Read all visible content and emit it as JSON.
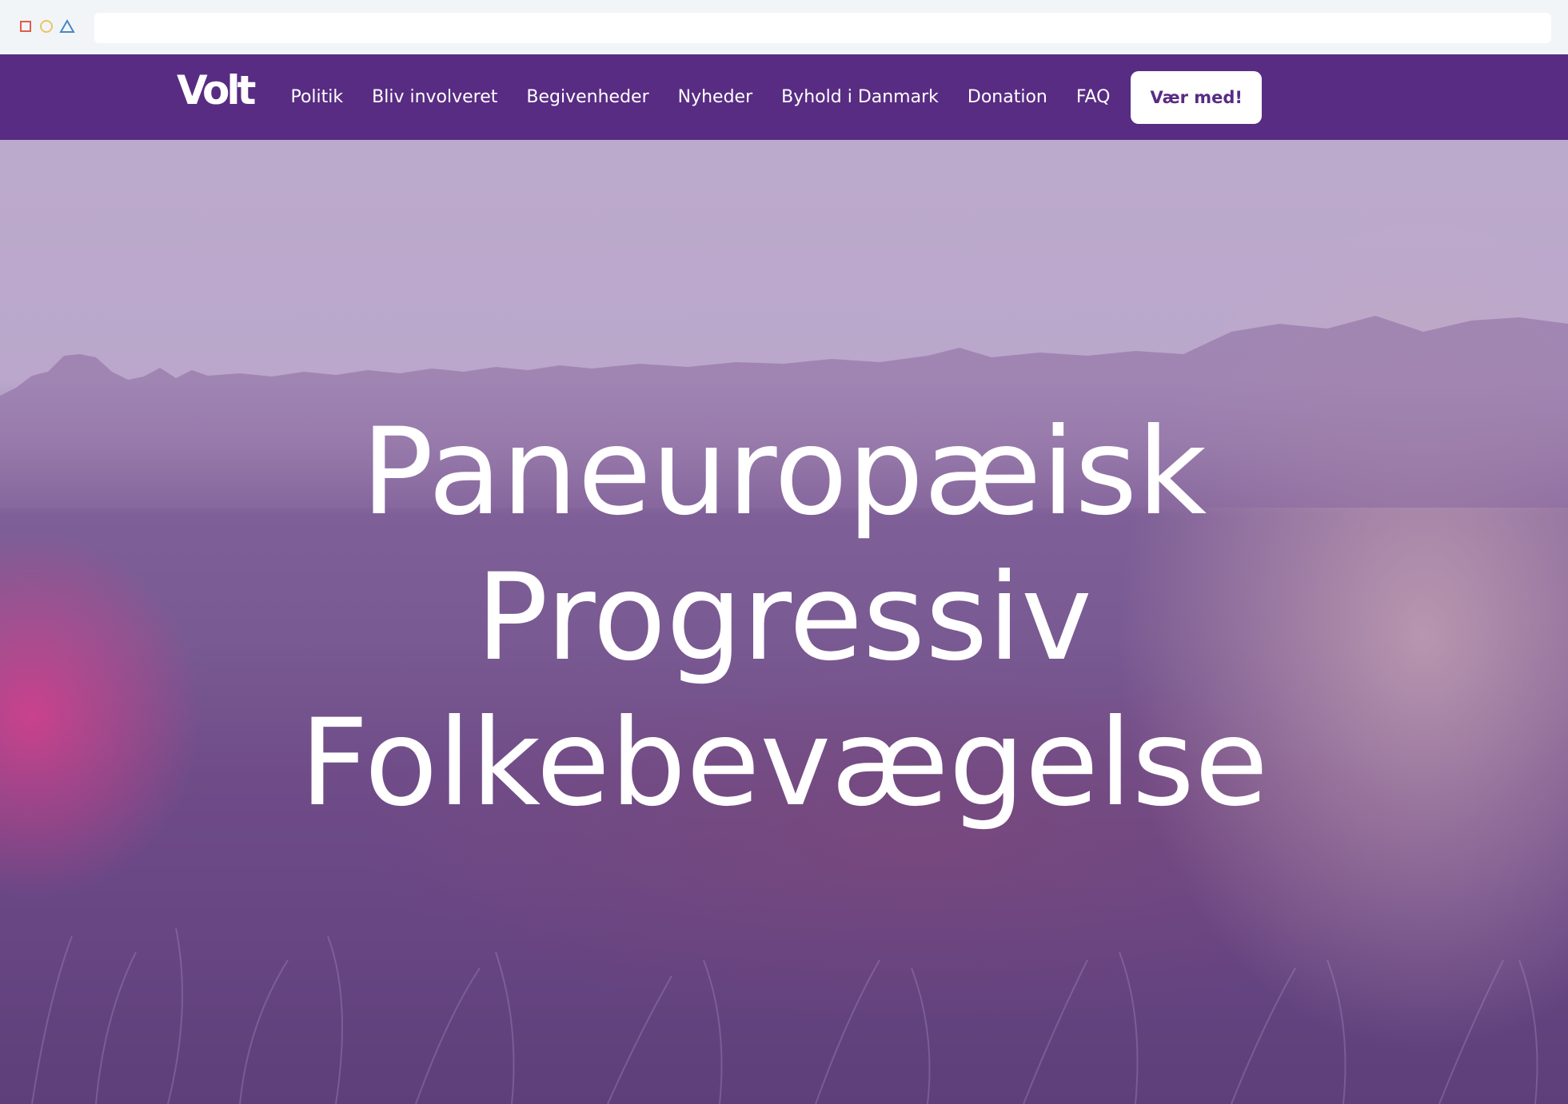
{
  "browser": {
    "address_value": ""
  },
  "nav": {
    "logo": "Volt",
    "links": [
      "Politik",
      "Bliv involveret",
      "Begivenheder",
      "Nyheder",
      "Byhold i Danmark",
      "Donation",
      "FAQ"
    ],
    "cta": "Vær med!"
  },
  "hero": {
    "lines": [
      "Paneuropæisk",
      "Progressiv",
      "Folkebevægelse"
    ]
  },
  "colors": {
    "brand_purple": "#582c83",
    "white": "#ffffff",
    "chrome_bg": "#f2f5f7"
  },
  "icons": {
    "close": "close-square-icon",
    "minimize": "minimize-circle-icon",
    "maximize": "maximize-triangle-icon"
  }
}
